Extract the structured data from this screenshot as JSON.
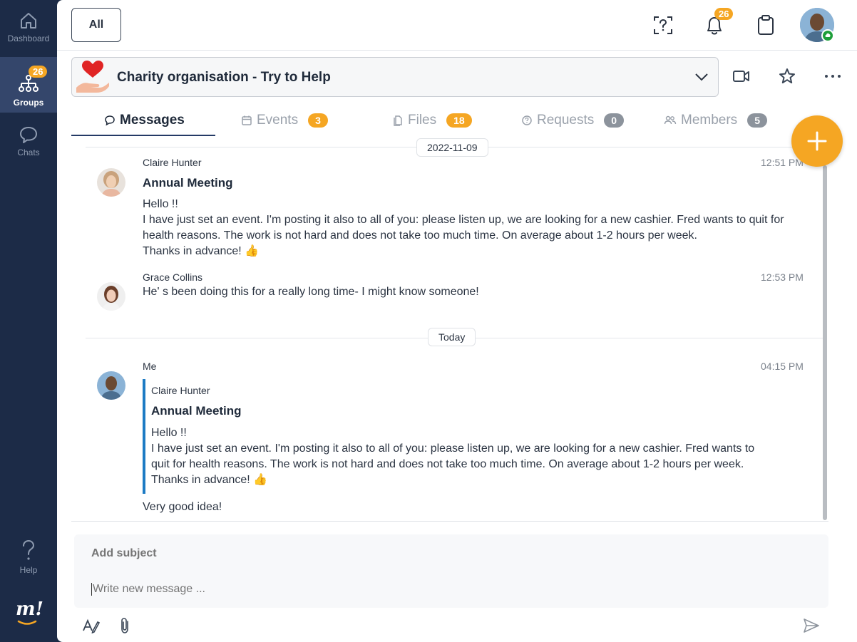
{
  "sidebar": {
    "items": [
      {
        "label": "Dashboard",
        "icon": "home-icon"
      },
      {
        "label": "Groups",
        "icon": "groups-icon",
        "badge": "26"
      },
      {
        "label": "Chats",
        "icon": "chat-bubble-icon"
      },
      {
        "label": "Help",
        "icon": "question-icon"
      }
    ],
    "logo_text": "m!"
  },
  "topbar": {
    "filter_label": "All",
    "notifications_badge": "26"
  },
  "group": {
    "name": "Charity organisation - Try to Help"
  },
  "tabs": [
    {
      "label": "Messages"
    },
    {
      "label": "Events",
      "badge": "3"
    },
    {
      "label": "Files",
      "badge": "18"
    },
    {
      "label": "Requests",
      "badge": "0"
    },
    {
      "label": "Members",
      "badge": "5"
    }
  ],
  "messages": {
    "date_1": "2022-11-09",
    "date_2": "Today",
    "m1": {
      "sender": "Claire Hunter",
      "time": "12:51 PM",
      "subject": "Annual Meeting",
      "lines": [
        "Hello !!",
        "I have just set an event. I'm posting it also to all of you: please listen up, we are looking for a new cashier. Fred wants to quit for",
        "health reasons. The work is not hard and does not take too much time. On average about 1-2 hours per week.",
        "Thanks in advance! 👍"
      ]
    },
    "m2": {
      "sender": "Grace Collins",
      "time": "12:53 PM",
      "text": "He' s been doing this for a really long time-  I might know someone!"
    },
    "m3": {
      "sender": "Me",
      "time": "04:15 PM",
      "quote": {
        "sender": "Claire Hunter",
        "subject": "Annual Meeting",
        "lines": [
          "Hello !!",
          "I have just set an event. I'm posting it also to all of you: please listen up, we are looking for a new cashier. Fred wants to",
          "quit for health reasons. The work is not hard and does not take too much time. On average about 1-2 hours per week.",
          "Thanks in advance! 👍"
        ]
      },
      "text": "Very good idea!"
    }
  },
  "composer": {
    "subject_placeholder": "Add subject",
    "message_placeholder": "Write new message ..."
  },
  "colors": {
    "sidebar": "#1c2b47",
    "accent": "#f5a623",
    "quote_bar": "#1d7bc4"
  }
}
